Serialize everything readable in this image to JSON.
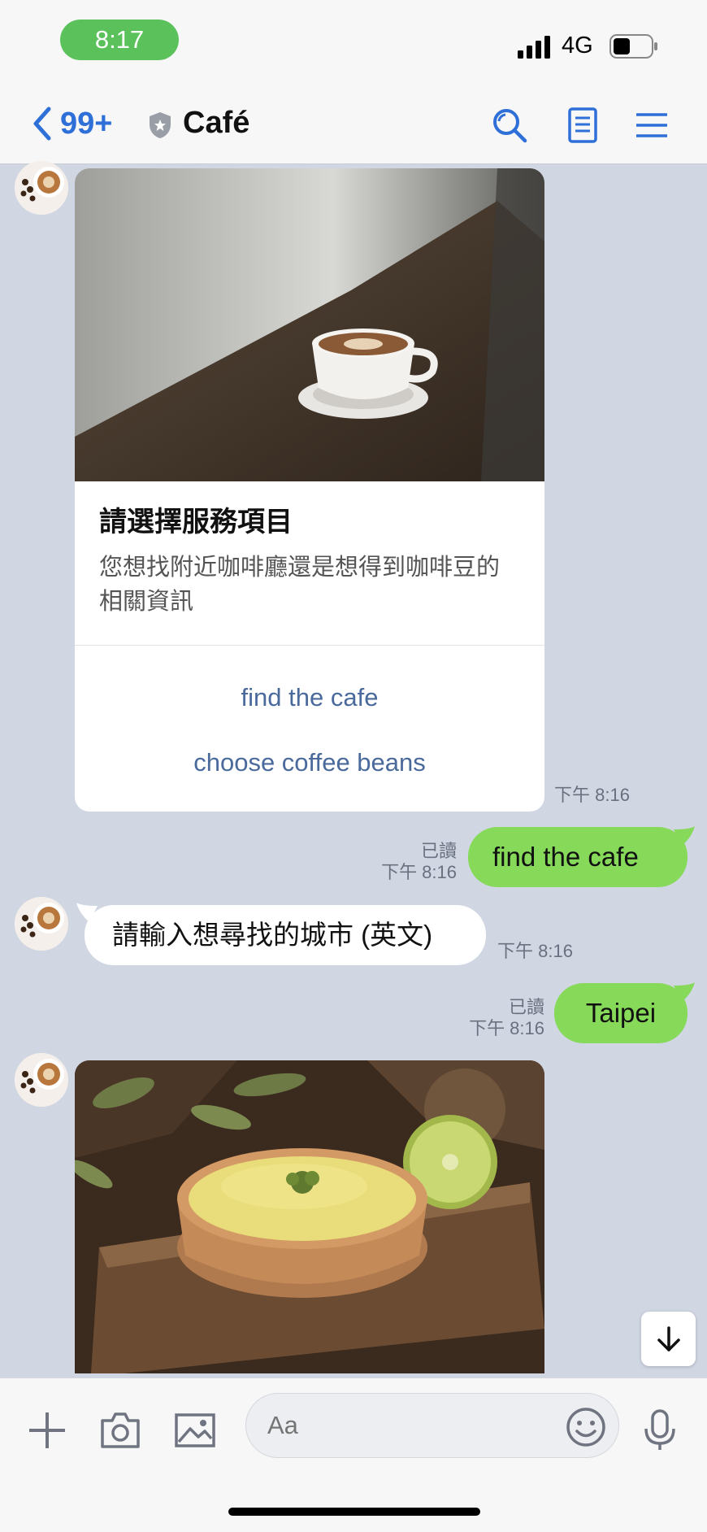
{
  "status_bar": {
    "time": "8:17",
    "network": "4G"
  },
  "nav": {
    "back_count": "99+",
    "title": "Café"
  },
  "messages": {
    "card": {
      "title": "請選擇服務項目",
      "text": "您想找附近咖啡廳還是想得到咖啡豆的相關資訊",
      "actions": [
        "find the cafe",
        "choose coffee beans"
      ],
      "time": "下午 8:16"
    },
    "out1": {
      "text": "find the cafe",
      "read": "已讀",
      "time": "下午 8:16"
    },
    "in1": {
      "text": "請輸入想尋找的城市 (英文)",
      "time": "下午 8:16"
    },
    "out2": {
      "text": "Taipei",
      "read": "已讀",
      "time": "下午 8:16"
    }
  },
  "input": {
    "placeholder": "Aa"
  },
  "colors": {
    "accent": "#2E6FD8",
    "bubble_out": "#87D95A",
    "background": "#D0D7E3"
  }
}
